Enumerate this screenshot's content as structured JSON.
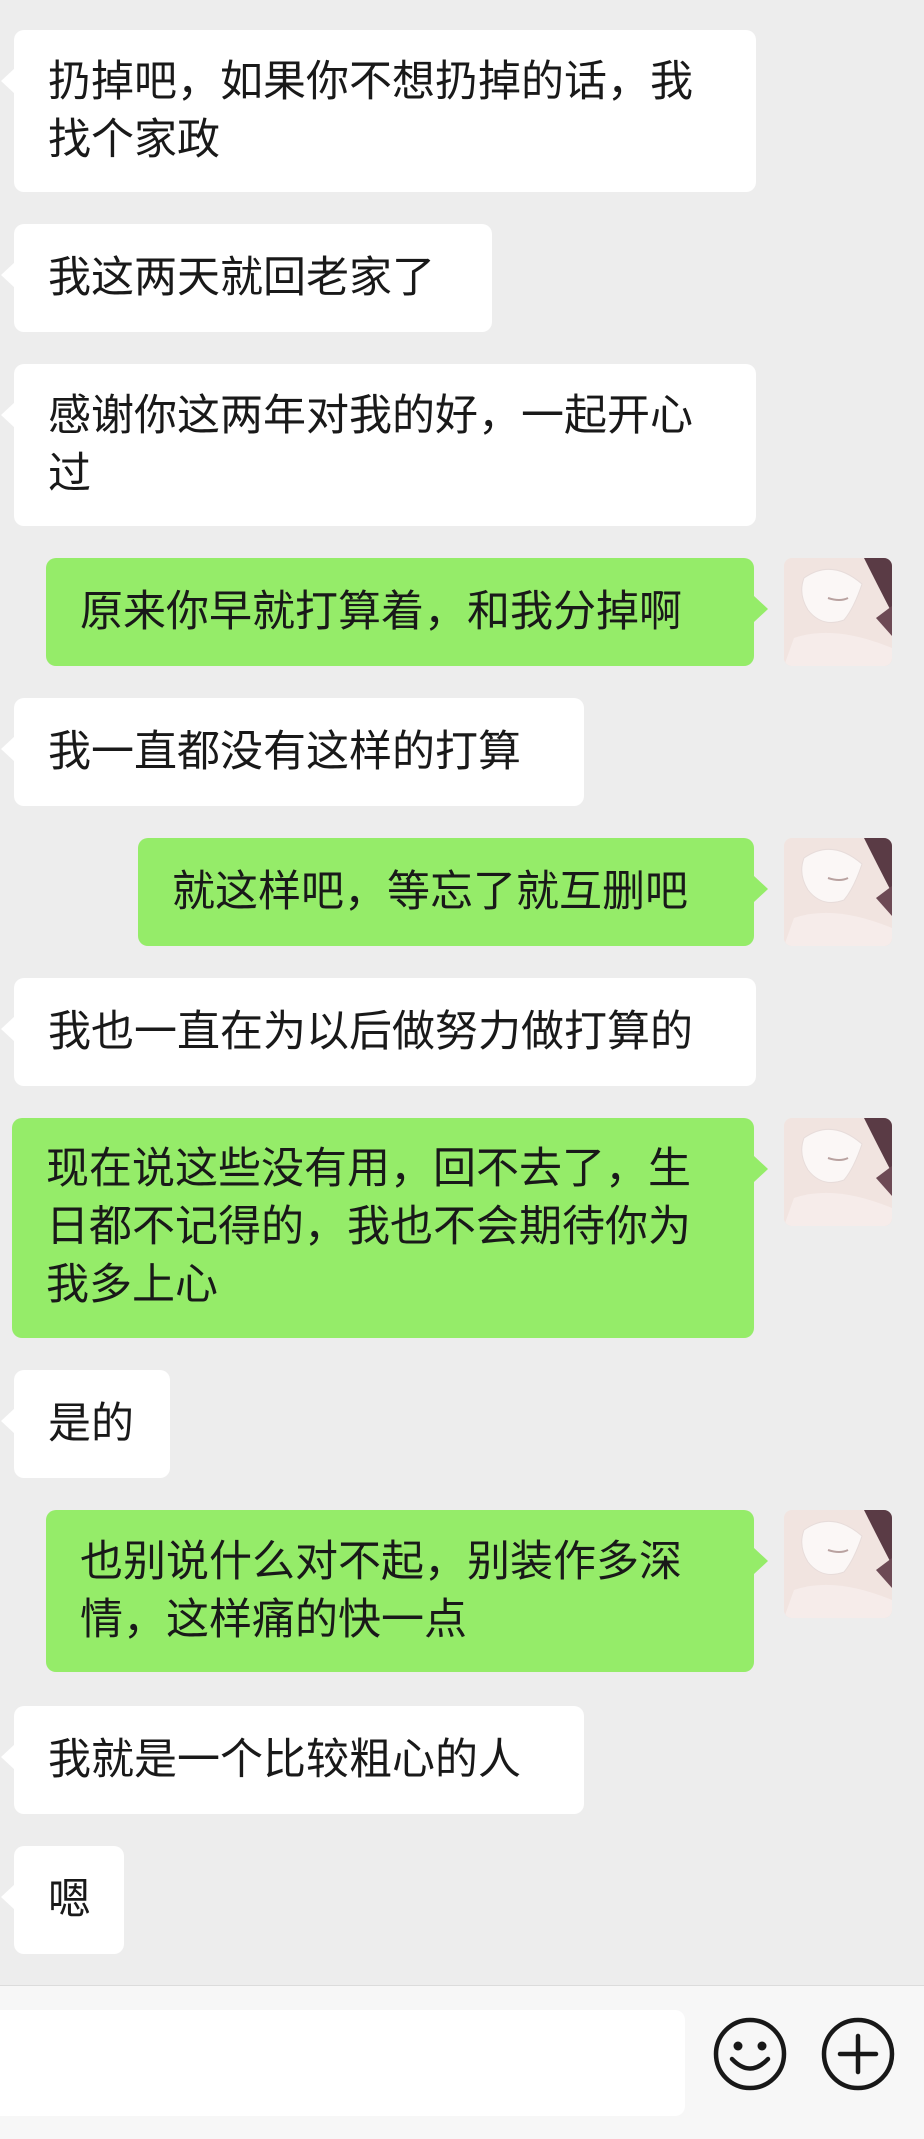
{
  "messages": [
    {
      "side": "in",
      "text": "扔掉吧，如果你不想扔掉的话，我\n找个家政"
    },
    {
      "side": "in",
      "text": "我这两天就回老家了"
    },
    {
      "side": "in",
      "text": "感谢你这两年对我的好，一起开心\n过"
    },
    {
      "side": "out",
      "text": "原来你早就打算着，和我分掉啊"
    },
    {
      "side": "in",
      "text": "我一直都没有这样的打算"
    },
    {
      "side": "out",
      "text": "就这样吧，等忘了就互删吧"
    },
    {
      "side": "in",
      "text": "我也一直在为以后做努力做打算的"
    },
    {
      "side": "out",
      "text": "现在说这些没有用，回不去了，生\n日都不记得的，我也不会期待你为\n我多上心"
    },
    {
      "side": "in",
      "text": "是的"
    },
    {
      "side": "out",
      "text": "也别说什么对不起，别装作多深\n情，这样痛的快一点"
    },
    {
      "side": "in",
      "text": "我就是一个比较粗心的人"
    },
    {
      "side": "in",
      "text": "嗯"
    }
  ],
  "input": {
    "value": "",
    "placeholder": ""
  },
  "icons": {
    "emoji": "emoji-icon",
    "plus": "plus-icon",
    "avatar": "avatar-anime-white-hair"
  },
  "colors": {
    "background": "#ededed",
    "incoming_bubble": "#ffffff",
    "outgoing_bubble": "#95ec69",
    "text": "#191919",
    "bottom_bar": "#f7f7f7"
  }
}
